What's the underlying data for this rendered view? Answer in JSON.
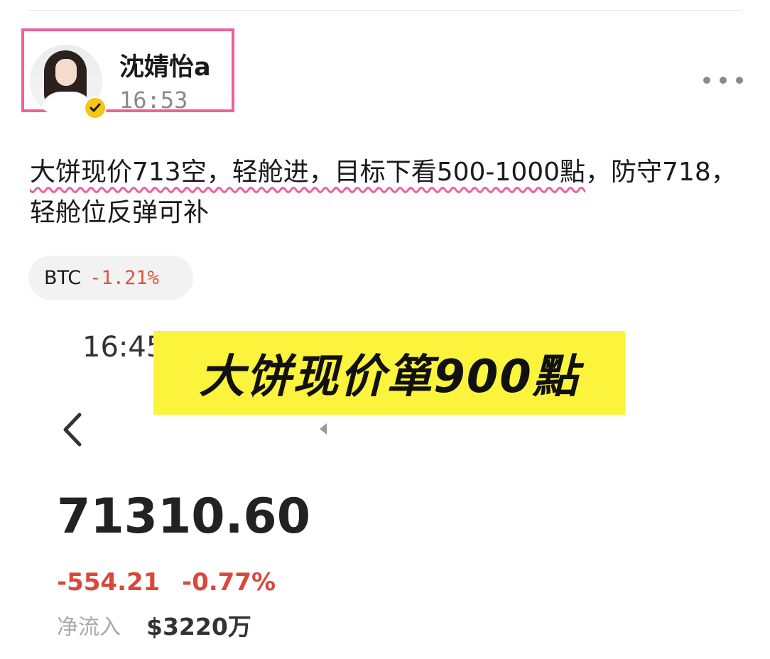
{
  "post": {
    "author_name": "沈婧怡a",
    "time": "16:53",
    "text_highlighted": "大饼现价713空，轻舱进，目标下看500-1000點",
    "text_rest": "，防守718，轻舱位反弹可补",
    "ticker": {
      "symbol": "BTC",
      "change": "-1.21%"
    }
  },
  "embedded_image": {
    "time": "16:45",
    "banner": "大饼现价箪900點",
    "price": "71310.60",
    "change_abs": "-554.21",
    "change_pct": "-0.77%",
    "netflow_label": "净流入",
    "netflow_value": "$3220万"
  },
  "colors": {
    "highlight_border": "#f0609a",
    "negative": "#e0533a",
    "banner_bg": "#fbf33c",
    "verified": "#f5c518"
  },
  "icons": {
    "more": "more-horizontal-icon",
    "verified": "verified-check-icon",
    "back": "chevron-left-icon",
    "arrow": "triangle-left-icon"
  }
}
